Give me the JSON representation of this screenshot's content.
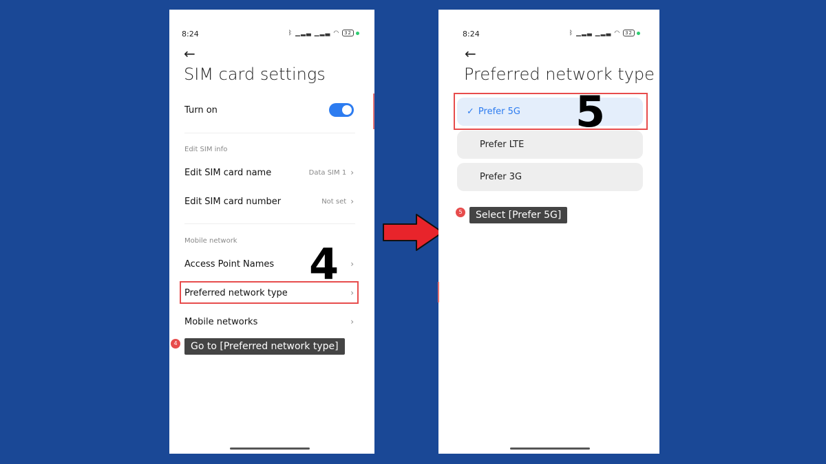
{
  "left": {
    "time": "8:24",
    "battery": "32",
    "title": "SIM card settings",
    "turn_on_label": "Turn on",
    "section_edit": "Edit SIM info",
    "edit_name_label": "Edit SIM card name",
    "edit_name_value": "Data SIM 1",
    "edit_number_label": "Edit SIM card number",
    "edit_number_value": "Not set",
    "section_mobile": "Mobile network",
    "apn_label": "Access Point Names",
    "preferred_label": "Preferred network type",
    "mobile_networks_label": "Mobile networks",
    "step_number": "4",
    "tip_badge": "4",
    "tip_text": "Go to [Preferred network type]"
  },
  "right": {
    "time": "8:24",
    "battery": "32",
    "title": "Preferred network type",
    "options": [
      {
        "label": "Prefer 5G",
        "selected": true
      },
      {
        "label": "Prefer LTE",
        "selected": false
      },
      {
        "label": "Prefer 3G",
        "selected": false
      }
    ],
    "step_number": "5",
    "tip_badge": "5",
    "tip_text": "Select [Prefer 5G]"
  },
  "colors": {
    "background": "#1a4896",
    "accent": "#2d7cf0",
    "highlight": "#e74c4c",
    "arrow": "#e8242b"
  }
}
